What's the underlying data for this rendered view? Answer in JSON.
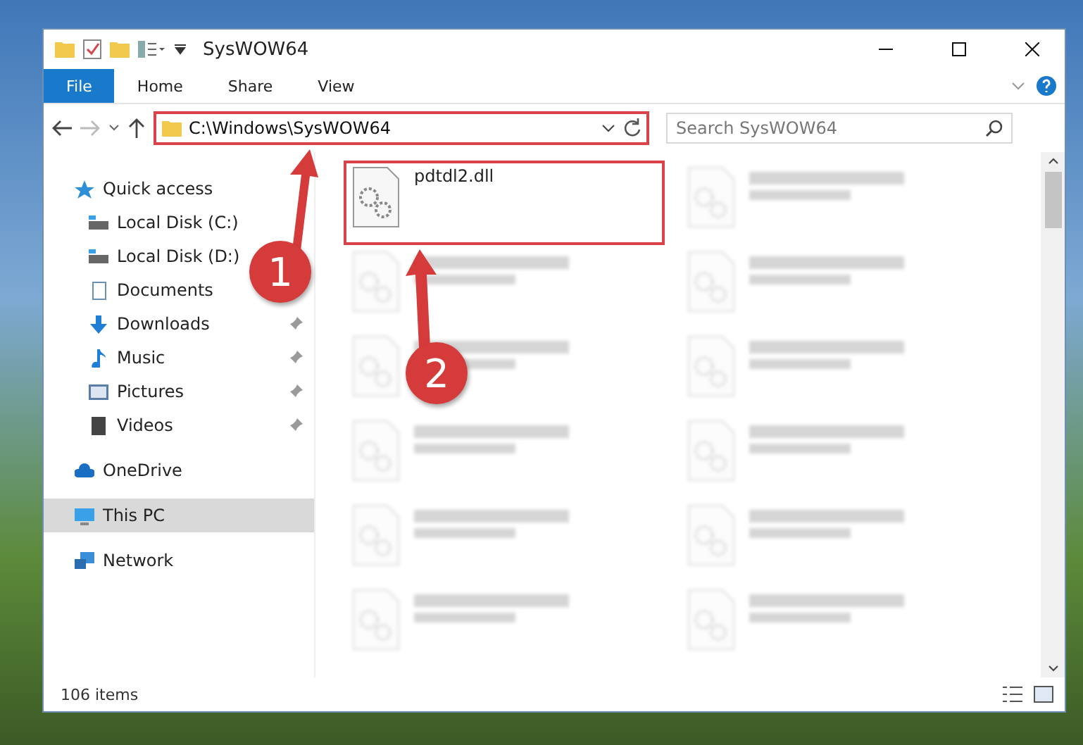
{
  "window": {
    "title": "SysWOW64"
  },
  "ribbon_tabs": [
    {
      "label": "File",
      "selected": true
    },
    {
      "label": "Home",
      "selected": false
    },
    {
      "label": "Share",
      "selected": false
    },
    {
      "label": "View",
      "selected": false
    }
  ],
  "address_bar": {
    "path": "C:\\Windows\\SysWOW64",
    "highlighted": true
  },
  "search": {
    "placeholder": "Search SysWOW64"
  },
  "sidebar": {
    "items": [
      {
        "label": "Quick access",
        "kind": "star",
        "selected": false,
        "children": [
          {
            "label": "Local Disk (C:)",
            "kind": "drive",
            "selected": false,
            "pinned": false
          },
          {
            "label": "Local Disk (D:)",
            "kind": "drive",
            "selected": false,
            "pinned": false
          },
          {
            "label": "Documents",
            "kind": "documents",
            "selected": false,
            "pinned": false
          },
          {
            "label": "Downloads",
            "kind": "downloads",
            "selected": false,
            "pinned": true
          },
          {
            "label": "Music",
            "kind": "music",
            "selected": false,
            "pinned": true
          },
          {
            "label": "Pictures",
            "kind": "pictures",
            "selected": false,
            "pinned": true
          },
          {
            "label": "Videos",
            "kind": "videos",
            "selected": false,
            "pinned": true
          }
        ]
      },
      {
        "label": "OneDrive",
        "kind": "cloud",
        "selected": false
      },
      {
        "label": "This PC",
        "kind": "pc",
        "selected": true
      },
      {
        "label": "Network",
        "kind": "network",
        "selected": false
      }
    ]
  },
  "file": {
    "name": "pdtdl2.dll",
    "highlighted": true
  },
  "status_bar": {
    "count": "106 items"
  },
  "annotations": [
    {
      "number": "1"
    },
    {
      "number": "2"
    }
  ]
}
